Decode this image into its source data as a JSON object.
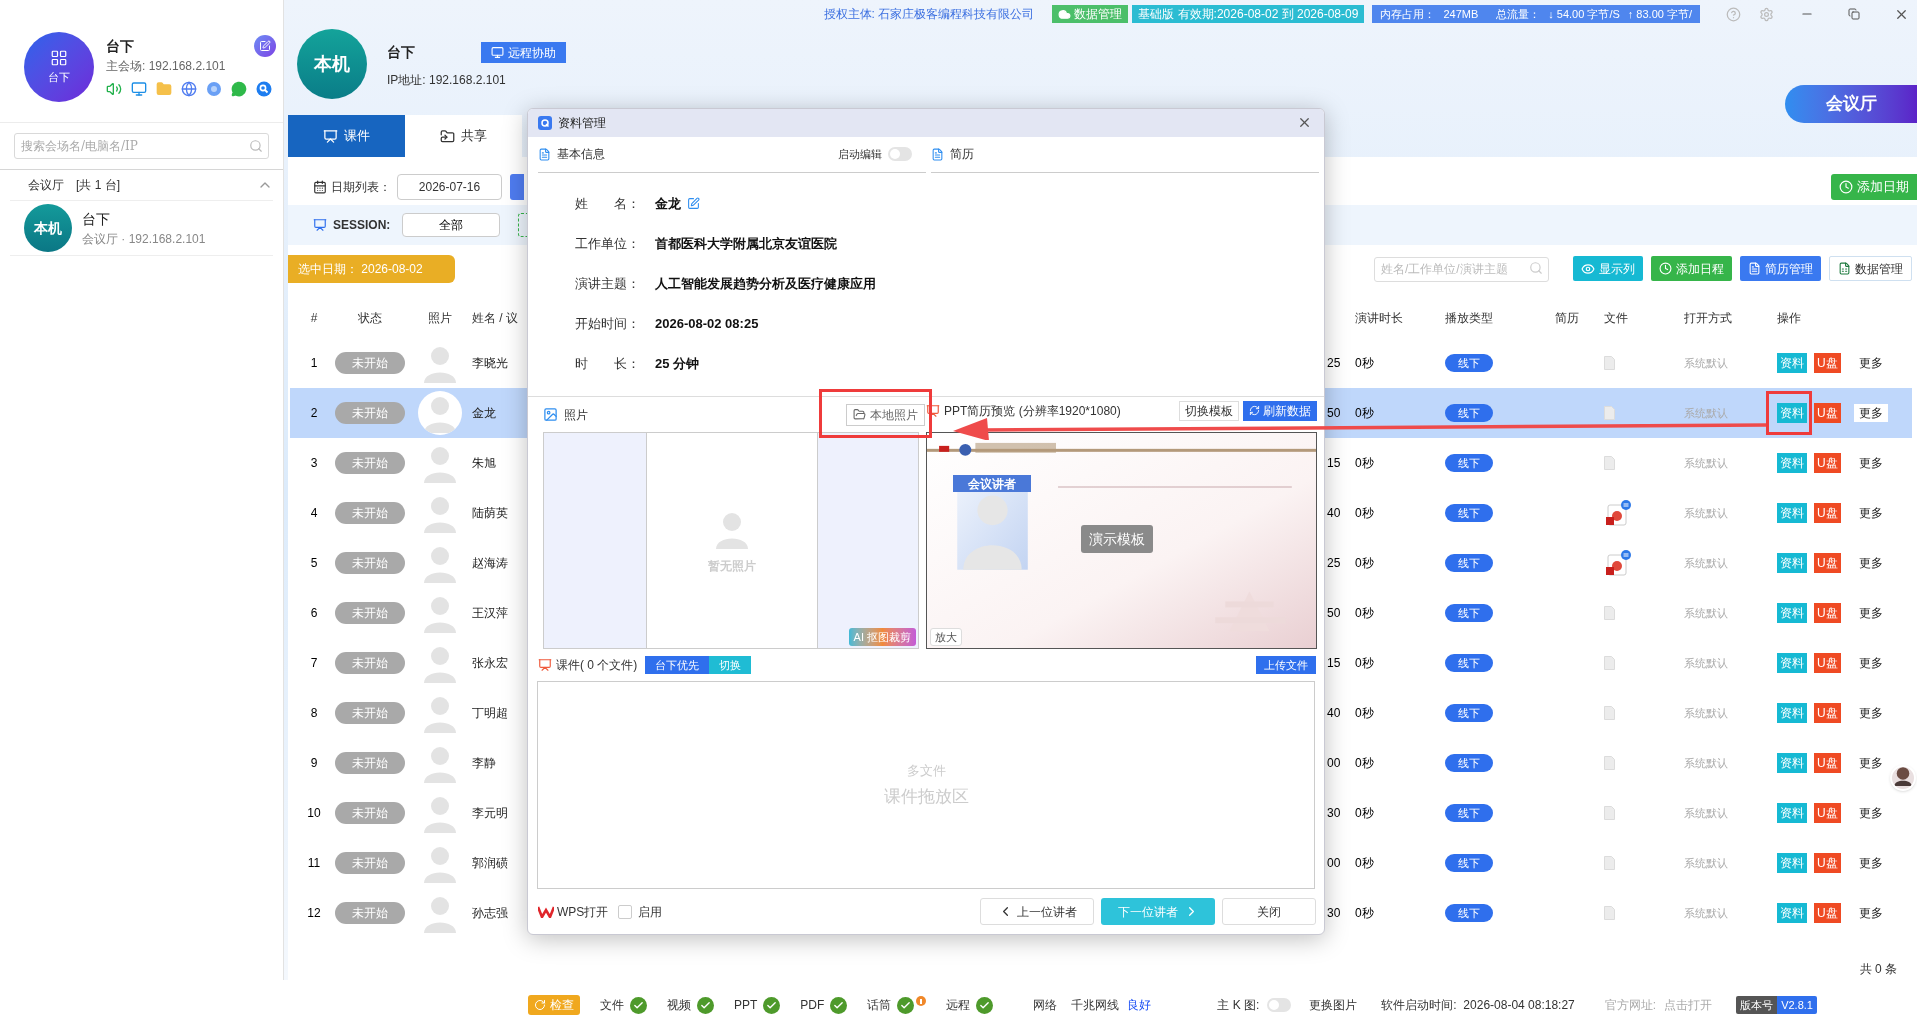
{
  "titlebar": {
    "license": "授权主体: 石家庄极客编程科技有限公司",
    "badges": [
      {
        "kind": "cloud",
        "text": "数据管理",
        "color": "#4cbf6a"
      },
      {
        "kind": "plain",
        "text": "基础版 有效期:2026-08-02 到 2026-08-09",
        "color": "#2bbcd2"
      }
    ],
    "stats": [
      "内存占用：",
      "247MB",
      "总流量：",
      "↓ 54.00 字节/S",
      "↑ 83.00 字节/"
    ]
  },
  "sidebar": {
    "logo_label": "台下",
    "name": "台下",
    "host": "主会场: 192.168.2.101",
    "search_placeholder": "搜索会场名/电脑名/IP",
    "group": {
      "label": "会议厅",
      "count": "[共 1 台]",
      "expanded": true
    },
    "devices": [
      {
        "badge": "本机",
        "name": "台下",
        "detail": "会议厅 · 192.168.2.101",
        "selected": false
      }
    ]
  },
  "header": {
    "badge": "本机",
    "name": "台下",
    "ip": "IP地址: 192.168.2.101",
    "remote_button": "远程协助",
    "hall_button": "会议厅"
  },
  "tabs": [
    {
      "label": "课件",
      "selected": true
    },
    {
      "label": "共享",
      "selected": false
    }
  ],
  "filters": {
    "date_label": "日期列表：",
    "date": "2026-07-16",
    "add_date": "添加日期",
    "session_label": "SESSION:",
    "session": "全部",
    "selected_date": "选中日期： 2026-08-02"
  },
  "toolbar": {
    "search_placeholder": "姓名/工作单位/演讲主题",
    "buttons": [
      {
        "kind": "eye",
        "label": "显示列"
      },
      {
        "kind": "clock",
        "label": "添加日程"
      },
      {
        "kind": "resume",
        "label": "简历管理"
      },
      {
        "kind": "sheet",
        "label": "数据管理"
      }
    ]
  },
  "table": {
    "columns_left": [
      "#",
      "状态",
      "照片",
      "姓名 / 议"
    ],
    "columns_right": [
      "演讲时长",
      "播放类型",
      "简历",
      "文件",
      "打开方式",
      "操作"
    ],
    "rows": [
      {
        "index": "1",
        "status": "未开始",
        "name": "李晓光",
        "column_5": "25",
        "duration": "0秒",
        "play_type": "线下",
        "file": {
          "kind": "blank"
        },
        "open_mode": "系统默认",
        "info": "资料",
        "usb": "U盘",
        "more": "更多",
        "selected": false
      },
      {
        "index": "2",
        "status": "未开始",
        "name": "金龙",
        "column_5": "50",
        "duration": "0秒",
        "play_type": "线下",
        "file": {
          "kind": "blank"
        },
        "open_mode": "系统默认",
        "info": "资料",
        "usb": "U盘",
        "more": "更多",
        "selected": true
      },
      {
        "index": "3",
        "status": "未开始",
        "name": "朱旭",
        "column_5": "15",
        "duration": "0秒",
        "play_type": "线下",
        "file": {
          "kind": "blank"
        },
        "open_mode": "系统默认",
        "info": "资料",
        "usb": "U盘",
        "more": "更多",
        "selected": false
      },
      {
        "index": "4",
        "status": "未开始",
        "name": "陆荫英",
        "column_5": "40",
        "duration": "0秒",
        "play_type": "线下",
        "file": {
          "kind": "ppt"
        },
        "open_mode": "系统默认",
        "info": "资料",
        "usb": "U盘",
        "more": "更多",
        "selected": false
      },
      {
        "index": "5",
        "status": "未开始",
        "name": "赵海涛",
        "column_5": "25",
        "duration": "0秒",
        "play_type": "线下",
        "file": {
          "kind": "ppt"
        },
        "open_mode": "系统默认",
        "info": "资料",
        "usb": "U盘",
        "more": "更多",
        "selected": false
      },
      {
        "index": "6",
        "status": "未开始",
        "name": "王汉萍",
        "column_5": "50",
        "duration": "0秒",
        "play_type": "线下",
        "file": {
          "kind": "blank"
        },
        "open_mode": "系统默认",
        "info": "资料",
        "usb": "U盘",
        "more": "更多",
        "selected": false
      },
      {
        "index": "7",
        "status": "未开始",
        "name": "张永宏",
        "column_5": "15",
        "duration": "0秒",
        "play_type": "线下",
        "file": {
          "kind": "blank"
        },
        "open_mode": "系统默认",
        "info": "资料",
        "usb": "U盘",
        "more": "更多",
        "selected": false
      },
      {
        "index": "8",
        "status": "未开始",
        "name": "丁明超",
        "column_5": "40",
        "duration": "0秒",
        "play_type": "线下",
        "file": {
          "kind": "blank"
        },
        "open_mode": "系统默认",
        "info": "资料",
        "usb": "U盘",
        "more": "更多",
        "selected": false
      },
      {
        "index": "9",
        "status": "未开始",
        "name": "李静",
        "column_5": "00",
        "duration": "0秒",
        "play_type": "线下",
        "file": {
          "kind": "blank"
        },
        "open_mode": "系统默认",
        "info": "资料",
        "usb": "U盘",
        "more": "更多",
        "selected": false
      },
      {
        "index": "10",
        "status": "未开始",
        "name": "李元明",
        "column_5": "30",
        "duration": "0秒",
        "play_type": "线下",
        "file": {
          "kind": "blank"
        },
        "open_mode": "系统默认",
        "info": "资料",
        "usb": "U盘",
        "more": "更多",
        "selected": false
      },
      {
        "index": "11",
        "status": "未开始",
        "name": "郭润磺",
        "column_5": "00",
        "duration": "0秒",
        "play_type": "线下",
        "file": {
          "kind": "blank"
        },
        "open_mode": "系统默认",
        "info": "资料",
        "usb": "U盘",
        "more": "更多",
        "selected": false
      },
      {
        "index": "12",
        "status": "未开始",
        "name": "孙志强",
        "column_5": "30",
        "duration": "0秒",
        "play_type": "线下",
        "file": {
          "kind": "blank"
        },
        "open_mode": "系统默认",
        "info": "资料",
        "usb": "U盘",
        "more": "更多",
        "selected": false
      }
    ],
    "footer": "共 0 条"
  },
  "dialog": {
    "title": "资料管理",
    "basic_info": {
      "title": "基本信息",
      "edit_label": "启动编辑",
      "edit_on": false,
      "fields": [
        {
          "label": "姓　　名：",
          "value": "金龙",
          "editable": true
        },
        {
          "label": "工作单位：",
          "value": "首都医科大学附属北京友谊医院",
          "editable": false
        },
        {
          "label": "演讲主题：",
          "value": "人工智能发展趋势分析及医疗健康应用",
          "editable": false
        },
        {
          "label": "开始时间：",
          "value": "2026-08-02 08:25",
          "editable": false
        },
        {
          "label": "时　　长：",
          "value": "25 分钟",
          "editable": false
        }
      ]
    },
    "resume": {
      "title": "简历"
    },
    "photo": {
      "title": "照片",
      "local_button": "本地照片",
      "empty_text": "暂无照片",
      "ai_button": "AI 抠图裁剪"
    },
    "ppt": {
      "title": "PPT简历预览 (分辨率1920*1080)",
      "switch_button": "切换模板",
      "refresh_button": "刷新数据",
      "slide_label": "会议讲者",
      "overlay": "演示模板",
      "zoom_button": "放大"
    },
    "courseware": {
      "title": "课件( 0 个文件)",
      "segments": [
        {
          "label": "台下优先",
          "color": "#2f6fed"
        },
        {
          "label": "切换",
          "color": "#1fbcd4"
        }
      ],
      "upload": "上传文件",
      "drop_hint": "多文件",
      "drop_title": "课件拖放区"
    },
    "footer": {
      "wps": "WPS打开",
      "enable_label": "启用",
      "enable_checked": false,
      "prev": "上一位讲者",
      "next": "下一位讲者",
      "close": "关闭"
    }
  },
  "status_bar": {
    "check": "检查",
    "items": [
      {
        "label": "文件",
        "ok": true,
        "warning": false
      },
      {
        "label": "视频",
        "ok": true,
        "warning": false
      },
      {
        "label": "PPT",
        "ok": true,
        "warning": false
      },
      {
        "label": "PDF",
        "ok": true,
        "warning": false
      },
      {
        "label": "话筒",
        "ok": true,
        "warning": true
      },
      {
        "label": "远程",
        "ok": true,
        "warning": false
      }
    ],
    "network": {
      "label": "网络",
      "type": "千兆网线",
      "quality": "良好"
    },
    "k_label": "主 K 图:",
    "k_on": false,
    "change_image": "更换图片",
    "startup": "软件启动时间:  2026-08-04 08:18:27",
    "website_label": "官方网址:",
    "website_link": "点击打开",
    "version_label": "版本号",
    "version": "V2.8.1"
  }
}
